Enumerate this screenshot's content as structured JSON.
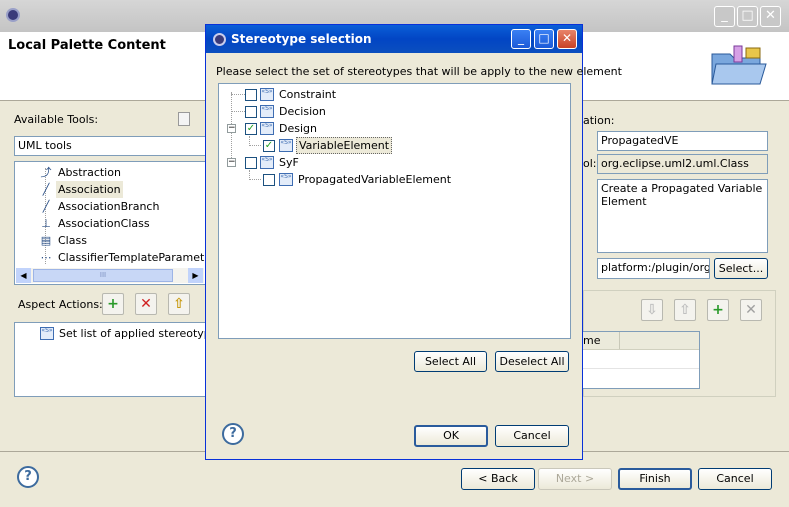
{
  "outer": {
    "title": "Local Palette Content",
    "available_tools_label": "Available Tools:",
    "toolset_value": "UML tools",
    "tools": [
      {
        "label": "Abstraction",
        "icon": "abstraction-icon"
      },
      {
        "label": "Association",
        "icon": "association-icon"
      },
      {
        "label": "AssociationBranch",
        "icon": "association-branch-icon"
      },
      {
        "label": "AssociationClass",
        "icon": "association-class-icon"
      },
      {
        "label": "Class",
        "icon": "class-icon"
      },
      {
        "label": "ClassifierTemplateParameter",
        "icon": "template-parameter-icon"
      }
    ],
    "scroll_grip": "III",
    "aspect_actions_label": "Aspect Actions:",
    "aspect_items": [
      "Set list of applied stereotypes"
    ],
    "right_label_1": "ation:",
    "right_label_2": "ol:",
    "name_value": "PropagatedVE",
    "class_value": "org.eclipse.uml2.uml.Class",
    "description_value": "Create a Propagated Variable Element",
    "icon_path_value": "platform:/plugin/org.ec",
    "select_button": "Select...",
    "table_header": "ime",
    "back_button": "< Back",
    "next_button": "Next >",
    "finish_button": "Finish",
    "cancel_button": "Cancel"
  },
  "dialog": {
    "title": "Stereotype selection",
    "instruction": "Please select the set of stereotypes that will be apply to the new element",
    "tree": [
      {
        "label": "Constraint",
        "checked": false
      },
      {
        "label": "Decision",
        "checked": false
      },
      {
        "label": "Design",
        "checked": true
      },
      {
        "label": "VariableElement",
        "checked": true
      },
      {
        "label": "SyF",
        "checked": false
      },
      {
        "label": "PropagatedVariableElement",
        "checked": false
      }
    ],
    "select_all": "Select All",
    "deselect_all": "Deselect All",
    "ok": "OK",
    "cancel": "Cancel"
  }
}
